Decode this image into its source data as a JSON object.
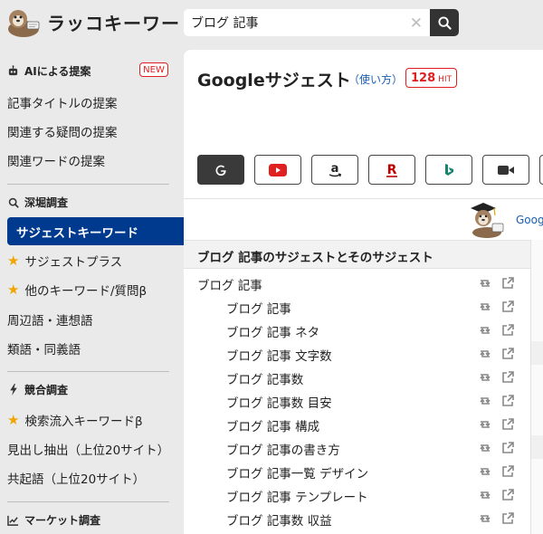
{
  "brand": "ラッコキーワード",
  "search": {
    "value": "ブログ 記事"
  },
  "sidebar": {
    "ai_section": {
      "label": "AIによる提案",
      "badge": "NEW"
    },
    "ai_items": [
      "記事タイトルの提案",
      "関連する疑問の提案",
      "関連ワードの提案"
    ],
    "deep_section": {
      "label": "深堀調査"
    },
    "deep_items": [
      {
        "label": "サジェストキーワード",
        "active": true
      },
      {
        "label": "サジェストプラス",
        "star": true
      },
      {
        "label": "他のキーワード/質問β",
        "star": true
      },
      {
        "label": "周辺語・連想語"
      },
      {
        "label": "類語・同義語"
      }
    ],
    "compete_section": {
      "label": "競合調査"
    },
    "compete_items": [
      {
        "label": "検索流入キーワードβ",
        "star": true
      },
      {
        "label": "見出し抽出（上位20サイト）"
      },
      {
        "label": "共起語（上位20サイト）"
      }
    ],
    "market_section": {
      "label": "マーケット調査"
    }
  },
  "main": {
    "title": "Googleサジェスト",
    "howto": "（使い方）",
    "hit_count": "128",
    "hit_label": "HIT",
    "engines": [
      {
        "name": "google",
        "selected": true
      },
      {
        "name": "youtube"
      },
      {
        "name": "amazon"
      },
      {
        "name": "rakuten"
      },
      {
        "name": "bing"
      },
      {
        "name": "video"
      }
    ],
    "google_link": "Goog",
    "results_header": "ブログ 記事のサジェストとそのサジェスト",
    "results": [
      {
        "kw": "ブログ 記事",
        "level": 0
      },
      {
        "kw": "ブログ 記事",
        "level": 1
      },
      {
        "kw": "ブログ 記事 ネタ",
        "level": 1
      },
      {
        "kw": "ブログ 記事 文字数",
        "level": 1
      },
      {
        "kw": "ブログ 記事数",
        "level": 1
      },
      {
        "kw": "ブログ 記事数 目安",
        "level": 1
      },
      {
        "kw": "ブログ 記事 構成",
        "level": 1
      },
      {
        "kw": "ブログ 記事の書き方",
        "level": 1
      },
      {
        "kw": "ブログ 記事一覧 デザイン",
        "level": 1
      },
      {
        "kw": "ブログ 記事 テンプレート",
        "level": 1
      },
      {
        "kw": "ブログ 記事数 収益",
        "level": 1
      }
    ]
  },
  "colors": {
    "active_nav": "#003a8f",
    "badge_red": "#e02020",
    "link_blue": "#1a5fb4",
    "star": "#f0a500"
  }
}
